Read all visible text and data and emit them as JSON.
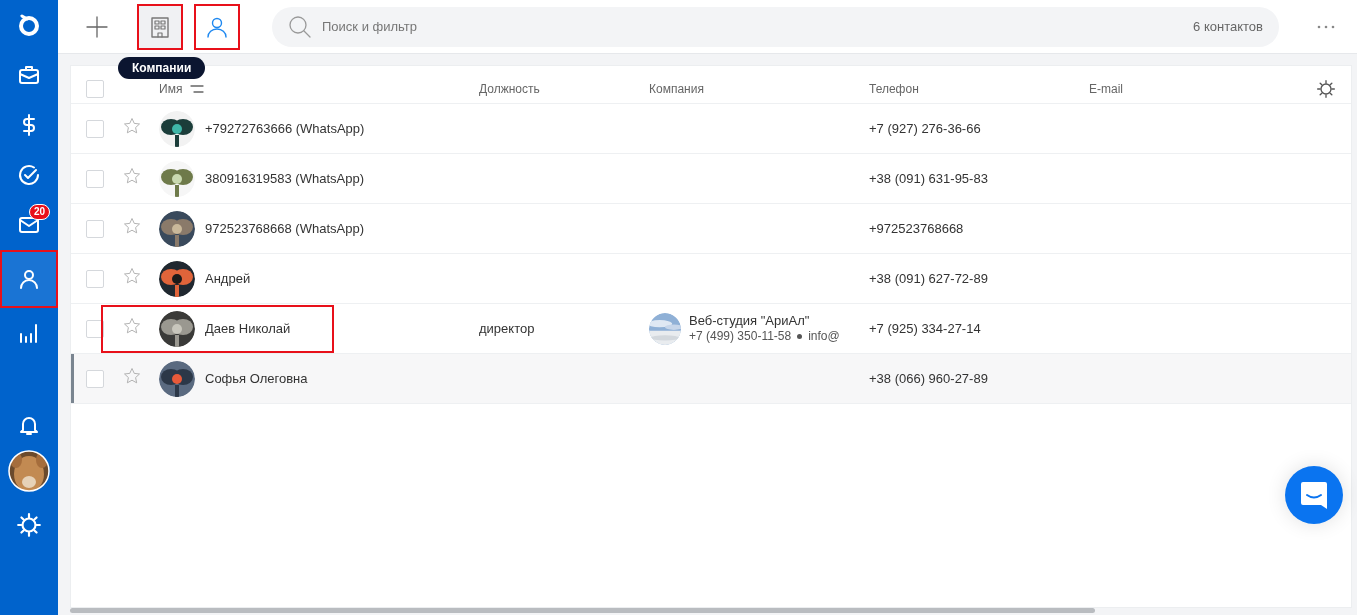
{
  "sidebar": {
    "items": [
      {
        "selected": false,
        "highlighted": false
      },
      {
        "selected": false,
        "highlighted": false
      },
      {
        "selected": false,
        "highlighted": false
      },
      {
        "selected": false,
        "highlighted": false,
        "badge": "20"
      },
      {
        "selected": true,
        "highlighted": true
      },
      {
        "selected": false,
        "highlighted": false
      }
    ]
  },
  "toolbar": {
    "buttons": [
      {
        "selected": false,
        "hovered": true,
        "highlighted": true
      },
      {
        "selected": true,
        "hovered": false,
        "highlighted": true
      }
    ],
    "tooltip": "Компании",
    "search": {
      "placeholder": "Поиск и фильтр",
      "count": "6 контактов"
    }
  },
  "table": {
    "header_checked": false,
    "columns": [
      "Имя",
      "Должность",
      "Компания",
      "Телефон",
      "E-mail"
    ],
    "rows": [
      {
        "checked": false,
        "favorite": false,
        "selected": false,
        "highlighted": false,
        "name": "+79272763666 (WhatsApp)",
        "phone": "+7 (927) 276-36-66"
      },
      {
        "checked": false,
        "favorite": false,
        "selected": false,
        "highlighted": false,
        "name": "380916319583 (WhatsApp)",
        "phone": "+38 (091) 631-95-83"
      },
      {
        "checked": false,
        "favorite": false,
        "selected": false,
        "highlighted": false,
        "name": "972523768668 (WhatsApp)",
        "phone": "+972523768668"
      },
      {
        "checked": false,
        "favorite": false,
        "selected": false,
        "highlighted": false,
        "name": "Андрей",
        "phone": "+38 (091) 627-72-89"
      },
      {
        "checked": false,
        "favorite": false,
        "selected": false,
        "highlighted": true,
        "name": "Даев Николай",
        "position": "директор",
        "company": {
          "name": "Веб-студия \"АриАл\"",
          "phone": "+7 (499) 350-11-58",
          "email": "info@"
        },
        "phone": "+7 (925) 334-27-14"
      },
      {
        "checked": false,
        "favorite": false,
        "selected": true,
        "highlighted": false,
        "name": "Софья Олеговна",
        "phone": "+38 (066) 960-27-89"
      }
    ]
  }
}
